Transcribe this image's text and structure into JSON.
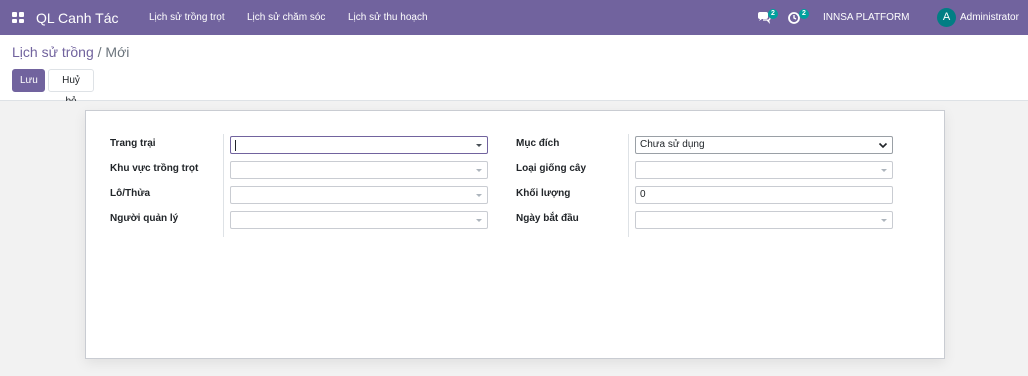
{
  "navbar": {
    "app_title": "QL Canh Tác",
    "menu": [
      {
        "label": "Lịch sử trồng trọt"
      },
      {
        "label": "Lịch sử chăm sóc"
      },
      {
        "label": "Lịch sử thu hoạch"
      }
    ],
    "messages_count": "2",
    "activities_count": "2",
    "company": "INNSA PLATFORM",
    "user_initial": "A",
    "user_name": "Administrator",
    "bar_color": "#71639e"
  },
  "breadcrumb": {
    "parent": "Lịch sử trồng",
    "separator": "/",
    "current": "Mới"
  },
  "buttons": {
    "save": "Lưu",
    "discard": "Huỷ bỏ"
  },
  "form": {
    "left": [
      {
        "label": "Trang trại",
        "value": ""
      },
      {
        "label": "Khu vực trồng trọt",
        "value": ""
      },
      {
        "label": "Lô/Thửa",
        "value": ""
      },
      {
        "label": "Người quản lý",
        "value": ""
      }
    ],
    "right": [
      {
        "label": "Mục đích",
        "value": "Chưa sử dụng"
      },
      {
        "label": "Loại giống cây",
        "value": ""
      },
      {
        "label": "Khối lượng",
        "value": "0"
      },
      {
        "label": "Ngày bắt đầu",
        "value": ""
      }
    ]
  }
}
